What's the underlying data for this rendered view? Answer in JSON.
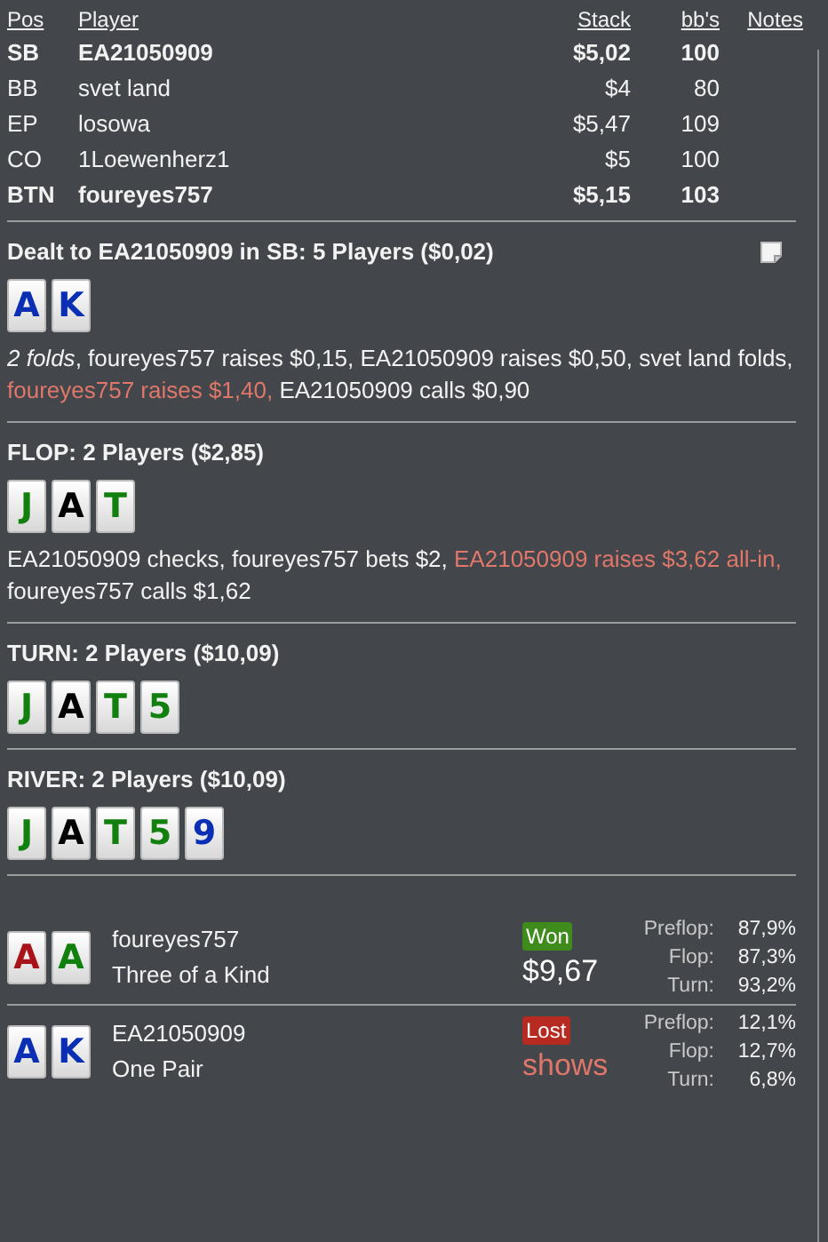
{
  "seats_table": {
    "columns": [
      "Pos",
      "Player",
      "Stack",
      "bb's",
      "Notes"
    ],
    "rows": [
      {
        "pos": "SB",
        "player": "EA21050909",
        "stack": "$5,02",
        "bbs": "100",
        "bold": true
      },
      {
        "pos": "BB",
        "player": "svet land",
        "stack": "$4",
        "bbs": "80",
        "bold": false
      },
      {
        "pos": "EP",
        "player": "losowa",
        "stack": "$5,47",
        "bbs": "109",
        "bold": false
      },
      {
        "pos": "CO",
        "player": "1Loewenherz1",
        "stack": "$5",
        "bbs": "100",
        "bold": false
      },
      {
        "pos": "BTN",
        "player": "foureyes757",
        "stack": "$5,15",
        "bbs": "103",
        "bold": true
      }
    ]
  },
  "streets": [
    {
      "title": "Dealt to EA21050909 in SB: 5 Players ($0,02)",
      "note_icon": true,
      "cards": [
        {
          "rank": "A",
          "color": "#0a2fb4"
        },
        {
          "rank": "K",
          "color": "#0a2fb4"
        }
      ],
      "actions": [
        {
          "text": "*2 folds*, foureyes757 raises $0,15, EA21050909 raises $0,50, svet land folds, ",
          "highlighted": false
        },
        {
          "text": "foureyes757 raises $1,40, ",
          "highlighted": true
        },
        {
          "text": "EA21050909 calls $0,90",
          "highlighted": false
        }
      ]
    },
    {
      "title": "FLOP: 2 Players ($2,85)",
      "cards": [
        {
          "rank": "J",
          "color": "#11800e"
        },
        {
          "rank": "A",
          "color": "#000000"
        },
        {
          "rank": "T",
          "color": "#11800e"
        }
      ],
      "actions": [
        {
          "text": "EA21050909 checks, foureyes757 bets $2, ",
          "highlighted": false
        },
        {
          "text": "EA21050909 raises $3,62 all-in, ",
          "highlighted": true
        },
        {
          "text": "foureyes757 calls $1,62",
          "highlighted": false
        }
      ]
    },
    {
      "title": "TURN: 2 Players ($10,09)",
      "cards": [
        {
          "rank": "J",
          "color": "#11800e"
        },
        {
          "rank": "A",
          "color": "#000000"
        },
        {
          "rank": "T",
          "color": "#11800e"
        },
        {
          "rank": "5",
          "color": "#11800e"
        }
      ]
    },
    {
      "title": "RIVER: 2 Players ($10,09)",
      "cards": [
        {
          "rank": "J",
          "color": "#11800e"
        },
        {
          "rank": "A",
          "color": "#000000"
        },
        {
          "rank": "T",
          "color": "#11800e"
        },
        {
          "rank": "5",
          "color": "#11800e"
        },
        {
          "rank": "9",
          "color": "#0a2fb4"
        }
      ]
    }
  ],
  "results": [
    {
      "cards": [
        {
          "rank": "A",
          "color": "#a8141a"
        },
        {
          "rank": "A",
          "color": "#11800e"
        }
      ],
      "player": "foureyes757",
      "hand": "Three of a Kind",
      "kind": "won",
      "badge": "Won",
      "amount": "$9,67",
      "equity": [
        {
          "label": "Preflop:",
          "value": "87,9%"
        },
        {
          "label": "Flop:",
          "value": "87,3%"
        },
        {
          "label": "Turn:",
          "value": "93,2%"
        }
      ]
    },
    {
      "cards": [
        {
          "rank": "A",
          "color": "#0a2fb4"
        },
        {
          "rank": "K",
          "color": "#0a2fb4"
        }
      ],
      "player": "EA21050909",
      "hand": "One Pair",
      "kind": "lost",
      "badge": "Lost",
      "amount": "shows",
      "equity": [
        {
          "label": "Preflop:",
          "value": "12,1%"
        },
        {
          "label": "Flop:",
          "value": "12,7%"
        },
        {
          "label": "Turn:",
          "value": "6,8%"
        }
      ]
    }
  ]
}
